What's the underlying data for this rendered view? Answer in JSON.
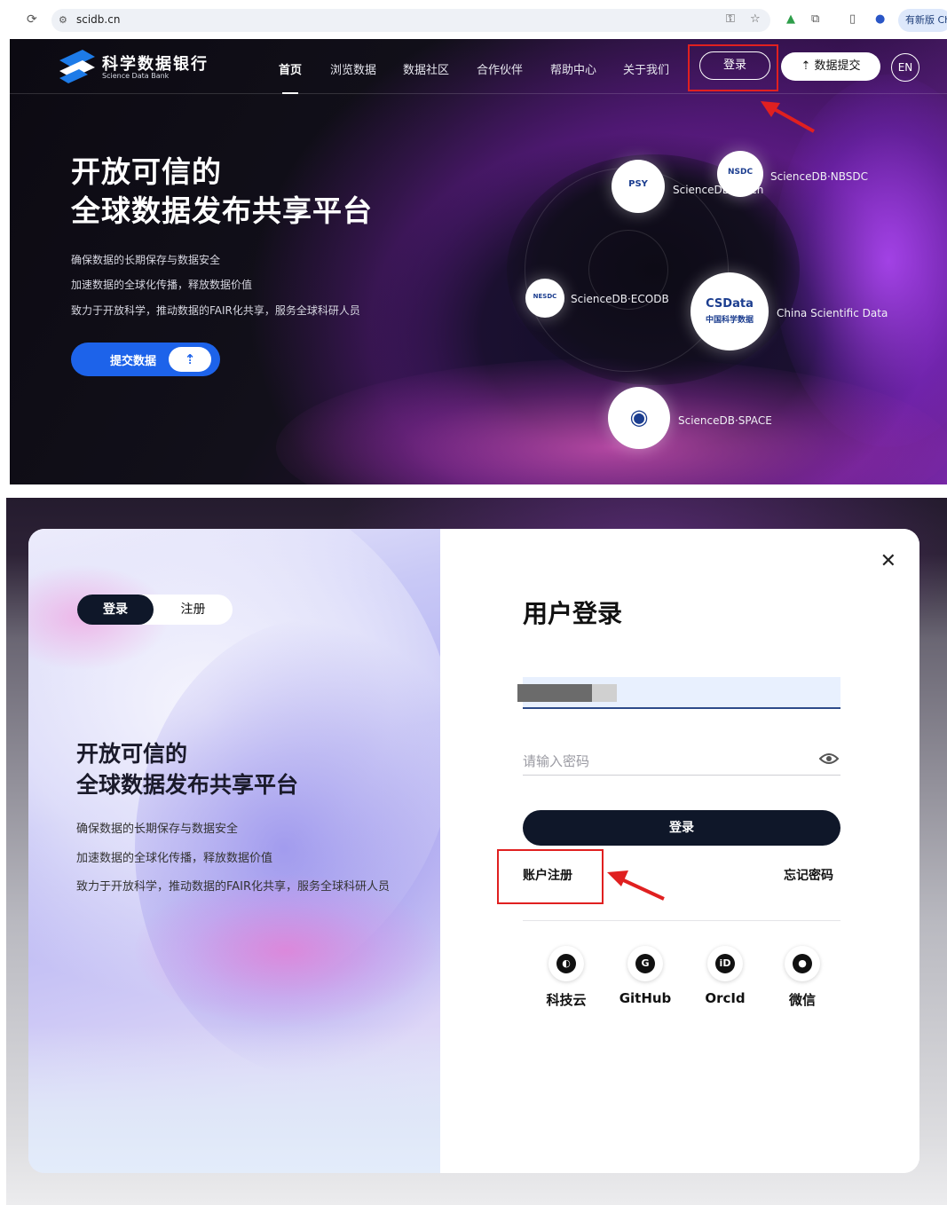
{
  "browser": {
    "url": "scidb.cn",
    "update_button": "有新版 Ch"
  },
  "site": {
    "logo_cn": "科学数据银行",
    "logo_en": "Science Data Bank",
    "nav": [
      "首页",
      "浏览数据",
      "数据社区",
      "合作伙伴",
      "帮助中心",
      "关于我们"
    ],
    "login_label": "登录",
    "submit_label": "数据提交",
    "lang_label": "EN",
    "hero_title_line1": "开放可信的",
    "hero_title_line2": "全球数据发布共享平台",
    "hero_lines": [
      "确保数据的长期保存与数据安全",
      "加速数据的全球化传播，释放数据价值",
      "致力于开放科学，推动数据的FAIR化共享，服务全球科研人员"
    ],
    "hero_cta": "提交数据",
    "nodes": {
      "psydb_logo": "PSY",
      "psydb_label": "ScienceDB·Psych",
      "nbsdc_logo": "NSDC",
      "nbsdc_label": "ScienceDB·NBSDC",
      "ecodb_logo": "NESDC",
      "ecodb_label": "ScienceDB·ECODB",
      "csdata_logo": "CSData",
      "csdata_sub": "中国科学数据",
      "csdata_label": "China Scientific Data",
      "space_label": "ScienceDB·SPACE"
    }
  },
  "modal": {
    "tab_login": "登录",
    "tab_register": "注册",
    "left_title_line1": "开放可信的",
    "left_title_line2": "全球数据发布共享平台",
    "left_lines": [
      "确保数据的长期保存与数据安全",
      "加速数据的全球化传播，释放数据价值",
      "致力于开放科学，推动数据的FAIR化共享，服务全球科研人员"
    ],
    "close_symbol": "✕",
    "heading": "用户登录",
    "password_placeholder": "请输入密码",
    "login_button": "登录",
    "register_link": "账户注册",
    "forgot_link": "忘记密码",
    "social": [
      {
        "name": "科技云",
        "icon": "cstcloud-icon",
        "glyph": "◐"
      },
      {
        "name": "GitHub",
        "icon": "github-icon",
        "glyph": "G"
      },
      {
        "name": "OrcId",
        "icon": "orcid-icon",
        "glyph": "iD"
      },
      {
        "name": "微信",
        "icon": "wechat-icon",
        "glyph": "●"
      }
    ]
  },
  "colors": {
    "accent_blue": "#1d63ea",
    "dark_button": "#0f1729",
    "highlight_red": "#e02020"
  }
}
